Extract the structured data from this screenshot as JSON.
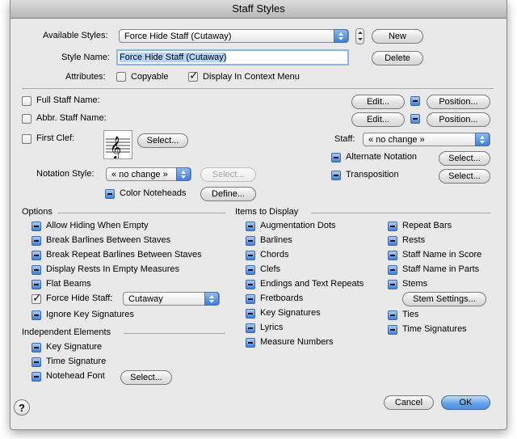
{
  "window": {
    "title": "Staff Styles"
  },
  "top": {
    "available_styles_label": "Available Styles:",
    "available_styles_value": "Force Hide Staff (Cutaway)",
    "new_button": "New",
    "style_name_label": "Style Name:",
    "style_name_value": "Force Hide Staff (Cutaway)",
    "delete_button": "Delete",
    "attributes_label": "Attributes:",
    "copyable_label": "Copyable",
    "copyable_checked": false,
    "display_context_label": "Display In Context Menu",
    "display_context_checked": true
  },
  "names": {
    "full_staff_name_label": "Full Staff Name:",
    "abbr_staff_name_label": "Abbr. Staff Name:",
    "edit_button": "Edit...",
    "position_button": "Position..."
  },
  "clef": {
    "first_clef_label": "First Clef:",
    "select_button": "Select...",
    "staff_label": "Staff:",
    "staff_value": "« no change »",
    "alternate_notation_label": "Alternate Notation",
    "transposition_label": "Transposition",
    "notation_style_label": "Notation Style:",
    "notation_style_value": "« no change »",
    "color_noteheads_label": "Color Noteheads",
    "define_button": "Define..."
  },
  "options": {
    "heading": "Options",
    "items": [
      {
        "label": "Allow Hiding When Empty",
        "state": "mixed"
      },
      {
        "label": "Break Barlines Between Staves",
        "state": "mixed"
      },
      {
        "label": "Break Repeat Barlines Between Staves",
        "state": "mixed"
      },
      {
        "label": "Display Rests In Empty Measures",
        "state": "mixed"
      },
      {
        "label": "Flat Beams",
        "state": "mixed"
      },
      {
        "label": "Force Hide Staff:",
        "state": "checked"
      },
      {
        "label": "Ignore Key Signatures",
        "state": "mixed"
      }
    ],
    "force_hide_value": "Cutaway"
  },
  "independent": {
    "heading": "Independent Elements",
    "items": [
      "Key Signature",
      "Time Signature",
      "Notehead Font"
    ],
    "select_button": "Select..."
  },
  "items_to_display": {
    "heading": "Items to Display",
    "col1": [
      "Augmentation Dots",
      "Barlines",
      "Chords",
      "Clefs",
      "Endings and Text Repeats",
      "Fretboards",
      "Key Signatures",
      "Lyrics",
      "Measure Numbers"
    ],
    "col2": [
      "Repeat Bars",
      "Rests",
      "Staff Name in Score",
      "Staff Name in Parts",
      "Stems",
      "Ties",
      "Time Signatures"
    ],
    "stem_settings_button": "Stem Settings..."
  },
  "footer": {
    "help_label": "?",
    "cancel_button": "Cancel",
    "ok_button": "OK"
  }
}
